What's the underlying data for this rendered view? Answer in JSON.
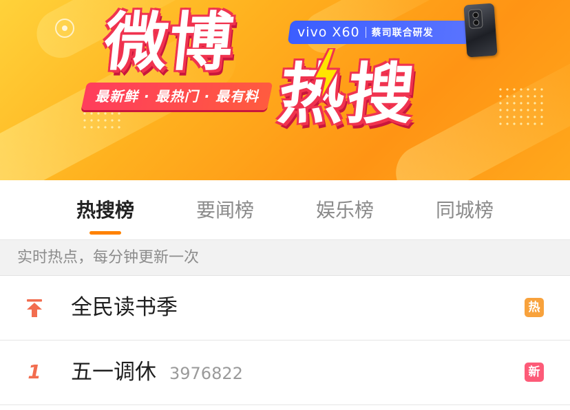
{
  "banner": {
    "title": "微博",
    "hot_word": "热搜",
    "slogan": "最新鲜 · 最热门 · 最有料",
    "sponsor_brand": "vivo X60",
    "sponsor_text": "蔡司联合研发"
  },
  "tabs": [
    {
      "label": "热搜榜",
      "active": true
    },
    {
      "label": "要闻榜",
      "active": false
    },
    {
      "label": "娱乐榜",
      "active": false
    },
    {
      "label": "同城榜",
      "active": false
    }
  ],
  "subheader": "实时热点，每分钟更新一次",
  "rows": [
    {
      "rank": "",
      "rank_icon": "pin-top-icon",
      "title": "全民读书季",
      "count": "",
      "badge": "热",
      "badge_color": "#f8a23c"
    },
    {
      "rank": "1",
      "title": "五一调休",
      "count": "3976822",
      "badge": "新",
      "badge_color": "#fd5b78"
    }
  ],
  "colors": {
    "accent": "#ff8200",
    "rank": "#f26d4f",
    "hot_badge": "#f8a23c",
    "new_badge": "#fd5b78"
  }
}
